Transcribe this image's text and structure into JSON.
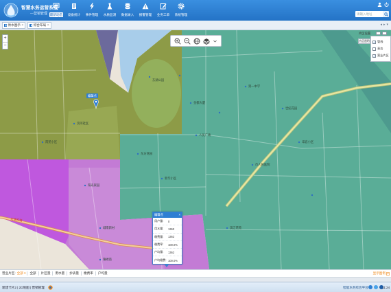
{
  "colors": {
    "header": "#2473c6",
    "accent": "#f08a1c",
    "olive": "#8d9b47",
    "teal": "#5aad97",
    "teal_dark": "#4d9a8e",
    "purple": "#c37bd5",
    "magenta": "#bf58de",
    "purple_light": "#c98ad8",
    "water": "#a8cdea",
    "navy": "#6c6a9c",
    "park": "#93b05c",
    "base": "#ebe5da"
  },
  "app": {
    "title": "智慧水务运营系统",
    "subtitle": "—营销管理",
    "logo_icon": "water-drop-logo"
  },
  "nav": [
    {
      "label": "最新动态",
      "icon": "monitor-icon",
      "active": true
    },
    {
      "label": "设备统计",
      "icon": "book-icon"
    },
    {
      "label": "事件管理",
      "icon": "lightning-icon"
    },
    {
      "label": "水质监测",
      "icon": "flask-icon"
    },
    {
      "label": "数据录入",
      "icon": "database-icon"
    },
    {
      "label": "报警管理",
      "icon": "warning-icon"
    },
    {
      "label": "业务工单",
      "icon": "edit-icon"
    },
    {
      "label": "系统管理",
      "icon": "gear-icon"
    }
  ],
  "header_tools": {
    "search_placeholder": "请输入地址",
    "icons": [
      "user-icon",
      "power-icon",
      "search-icon"
    ]
  },
  "tabs": [
    {
      "label": "供水图示",
      "icon": "map-icon"
    },
    {
      "label": "综合布局",
      "icon": "map-icon"
    }
  ],
  "tab_controls": [
    "◂",
    "▸",
    "▾"
  ],
  "map": {
    "zoom": {
      "in": "+",
      "out": "−"
    },
    "toolbar": [
      "zoom-in-icon",
      "zoom-out-icon",
      "globe-icon",
      "layers-icon",
      "chevron-down-icon"
    ],
    "layer_panel": {
      "title": "片区设置",
      "opacity_label": "片区透明",
      "items": [
        {
          "label": "管线",
          "checked": true
        },
        {
          "label": "表务",
          "checked": false
        },
        {
          "label": "营业片区",
          "checked": true
        }
      ]
    },
    "marker": {
      "label": "编辑点"
    },
    "popup": {
      "title": "编辑点",
      "close": "×",
      "rows": [
        {
          "k": "用户量:",
          "v": "0"
        },
        {
          "k": "用水量:",
          "v": "1360"
        },
        {
          "k": "缴费量:",
          "v": "1362"
        },
        {
          "k": "缴费率:",
          "v": "100.0%"
        },
        {
          "k": "户均量:",
          "v": "1362"
        },
        {
          "k": "户均缴费:",
          "v": "100.0%"
        }
      ]
    },
    "labels": [
      "滨河社区",
      "南苑小区",
      "东湖公园",
      "金都大厦",
      "人民广场",
      "第一中学",
      "世纪花园",
      "华庭小区",
      "东方花园",
      "新华小区",
      "市人民医院",
      "阳光家园",
      "城南新村",
      "锦绣苑",
      "滨江花苑"
    ],
    "road_label": "红旗东路"
  },
  "bottom_bar": {
    "label": "营业片区:",
    "active": "全部 ▾",
    "options": [
      "全部",
      "片区量",
      "用水量",
      "抄表量",
      "缴费率",
      "户均量"
    ],
    "legend": "显示图例"
  },
  "status": {
    "breadcrumb": "新建卡片2  |  2D地图  |  营销管理",
    "platform": "智能水务综合平台",
    "time": "11:24"
  }
}
